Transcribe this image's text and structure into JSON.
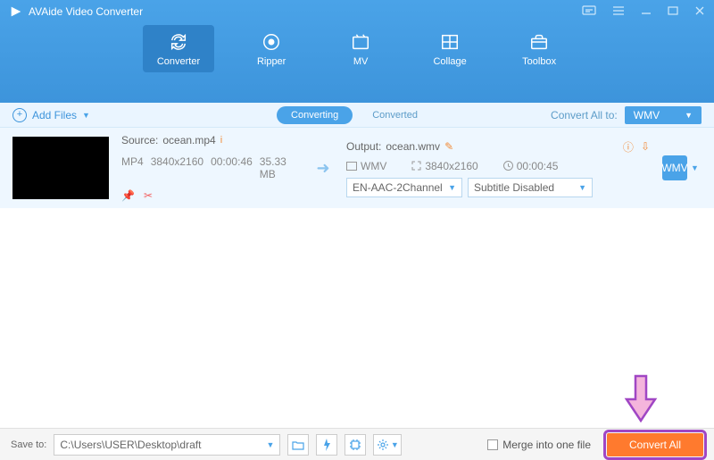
{
  "title": "AVAide Video Converter",
  "nav": {
    "converter": "Converter",
    "ripper": "Ripper",
    "mv": "MV",
    "collage": "Collage",
    "toolbox": "Toolbox"
  },
  "subbar": {
    "addfiles": "Add Files",
    "converting": "Converting",
    "converted": "Converted",
    "convertall_label": "Convert All to:",
    "convertall_fmt": "WMV"
  },
  "item": {
    "source_label": "Source:",
    "source_file": "ocean.mp4",
    "fmt": "MP4",
    "res": "3840x2160",
    "dur": "00:00:46",
    "size": "35.33 MB",
    "output_label": "Output:",
    "output_file": "ocean.wmv",
    "out_fmt": "WMV",
    "out_res": "3840x2160",
    "out_dur": "00:00:45",
    "audio_dd": "EN-AAC-2Channel",
    "sub_dd": "Subtitle Disabled",
    "fmt_box": "WMV"
  },
  "footer": {
    "saveto": "Save to:",
    "path": "C:\\Users\\USER\\Desktop\\draft",
    "merge": "Merge into one file",
    "convert": "Convert All"
  }
}
